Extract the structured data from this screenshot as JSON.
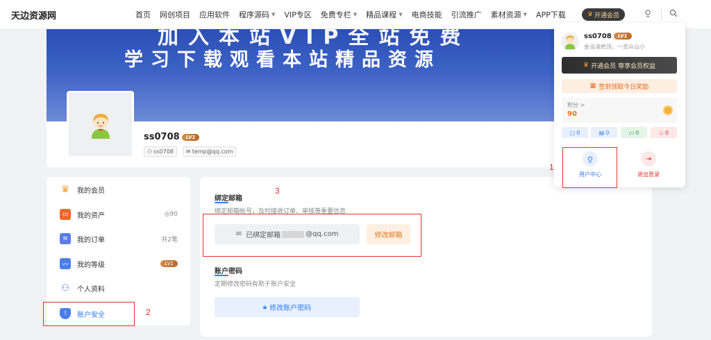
{
  "nav": {
    "logo": "天边资源网",
    "items": [
      {
        "label": "首页"
      },
      {
        "label": "网创项目"
      },
      {
        "label": "应用软件"
      },
      {
        "label": "程序源码",
        "caret": true
      },
      {
        "label": "VIP专区"
      },
      {
        "label": "免费专栏",
        "caret": true
      },
      {
        "label": "精品课程",
        "caret": true
      },
      {
        "label": "电商技能"
      },
      {
        "label": "引流推广"
      },
      {
        "label": "素材资源",
        "caret": true
      },
      {
        "label": "APP下载"
      }
    ],
    "vip_button": "开通会员"
  },
  "banner": {
    "line1": "加入本站VIP全站免费",
    "line2": "学习下载观看本站精品资源"
  },
  "profile": {
    "username": "ss0708",
    "level": "LV1",
    "tag_user": "ss0708",
    "tag_email": "temp@qq.com"
  },
  "sidebar": {
    "items": [
      {
        "label": "我的会员",
        "right": "",
        "icon": "crown-icon"
      },
      {
        "label": "我的资产",
        "right": "90",
        "icon": "wallet-icon"
      },
      {
        "label": "我的订单",
        "right": "共2笔",
        "icon": "order-icon"
      },
      {
        "label": "我的等级",
        "right": "LV1",
        "icon": "level-icon"
      },
      {
        "label": "个人资料",
        "right": "",
        "icon": "user-icon"
      },
      {
        "label": "账户安全",
        "right": "",
        "icon": "shield-icon"
      }
    ]
  },
  "main": {
    "email_section": {
      "title": "绑定邮箱",
      "desc": "绑定邮箱帐号，及时接收订单、审核等重要信息",
      "bound_label": "已绑定邮箱",
      "bound_suffix": "@qq.com",
      "change_button": "修改邮箱"
    },
    "password_section": {
      "title": "账户密码",
      "desc": "定期修改密码有助于账户安全",
      "change_button": "修改账户密码"
    }
  },
  "dropdown": {
    "username": "ss0708",
    "level": "LV1",
    "motto": "会当凌绝顶，一览众山小",
    "vip_bar": "开通会员 尊享会员权益",
    "sign_in": "签到领取今日奖励",
    "points_label": "积分 >",
    "points_value": "90",
    "stats": [
      {
        "value": "0",
        "color": "#2f7ef5",
        "bg": "#e8f0fd"
      },
      {
        "value": "0",
        "color": "#2f7ef5",
        "bg": "#e8f0fd"
      },
      {
        "value": "0",
        "color": "#27a046",
        "bg": "#e4f5e8"
      },
      {
        "value": "0",
        "color": "#e0302a",
        "bg": "#fde8e8"
      }
    ],
    "user_center": "用户中心",
    "logout": "退出登录"
  },
  "annotations": {
    "n1": "1",
    "n2": "2",
    "n3": "3"
  },
  "colors": {
    "accent_blue": "#2f7ef5",
    "accent_orange": "#e2761c",
    "annotation_red": "#e0302a"
  }
}
